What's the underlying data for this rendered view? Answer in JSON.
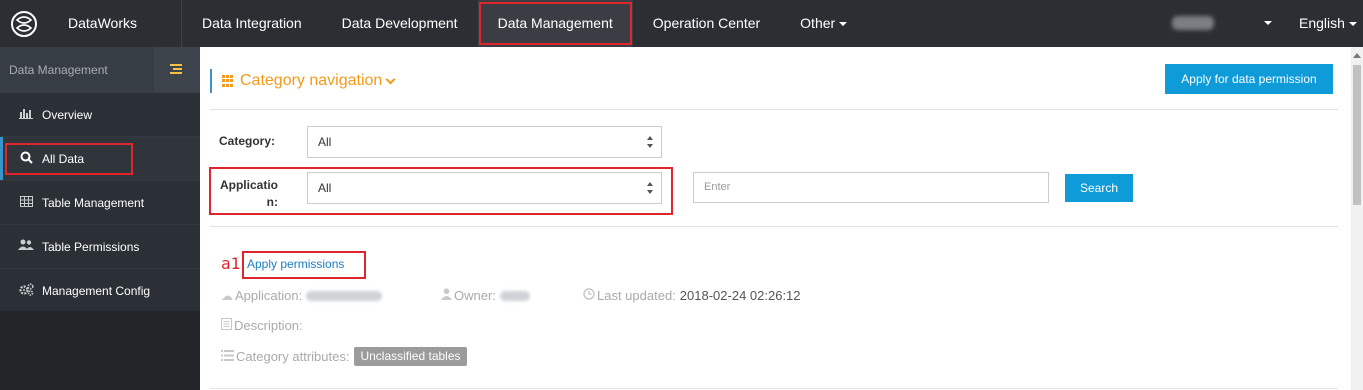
{
  "header": {
    "brand": "DataWorks",
    "nav": [
      {
        "label": "Data Integration"
      },
      {
        "label": "Data Development"
      },
      {
        "label": "Data Management"
      },
      {
        "label": "Operation Center"
      },
      {
        "label": "Other"
      }
    ],
    "language": "English"
  },
  "sidebar": {
    "title": "Data Management",
    "items": [
      {
        "label": "Overview",
        "icon": "bar-chart-icon"
      },
      {
        "label": "All Data",
        "icon": "search-icon"
      },
      {
        "label": "Table Management",
        "icon": "table-icon"
      },
      {
        "label": "Table Permissions",
        "icon": "users-icon"
      },
      {
        "label": "Management Config",
        "icon": "gears-icon"
      }
    ]
  },
  "main": {
    "category_nav": "Category navigation",
    "apply_data_permission": "Apply for data permission",
    "filters": {
      "category_label": "Category:",
      "category_value": "All",
      "application_label_1": "Applicatio",
      "application_label_2": "n:",
      "application_value": "All",
      "search_placeholder": "Enter",
      "search_button": "Search"
    },
    "record": {
      "name": "a1",
      "apply_link": "Apply permissions",
      "application_label": "Application:",
      "owner_label": "Owner:",
      "last_updated_label": "Last updated:",
      "last_updated_value": "2018-02-24 02:26:12",
      "description_label": "Description:",
      "category_attributes_label": "Category attributes:",
      "category_tag": "Unclassified tables"
    }
  },
  "colors": {
    "accent_blue": "#0e9bd8",
    "highlight_red": "#e0252c",
    "orange": "#f39a1b",
    "topbar": "#2b2e33",
    "sidebar": "#2b3036"
  }
}
